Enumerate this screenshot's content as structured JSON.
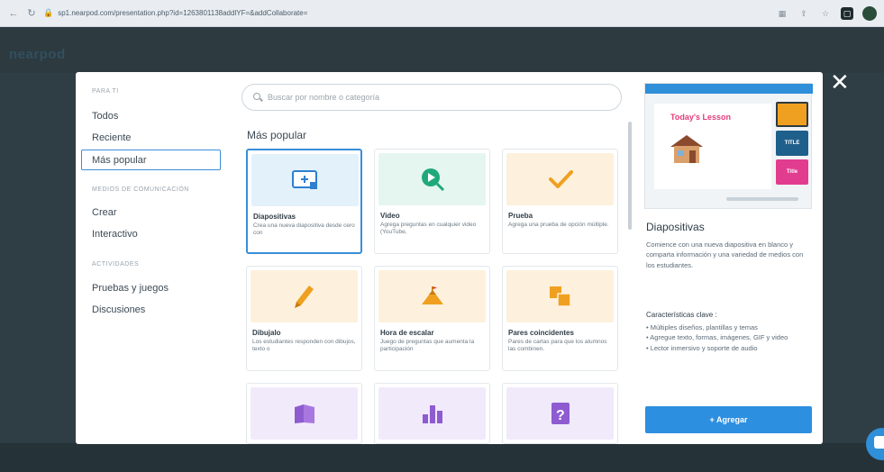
{
  "browser": {
    "url": "sp1.nearpod.com/presentation.php?id=1263801138addlYF=&addCollaborate=",
    "back_glyph": "←",
    "reload_glyph": "↻",
    "lock_glyph": "🔒"
  },
  "app": {
    "logo": "nearpod",
    "close_glyph": "✕"
  },
  "sidebar": {
    "section_1": "PARA TI",
    "items_1": [
      "Todos",
      "Reciente",
      "Más popular"
    ],
    "section_2": "MEDIOS DE COMUNICACIÓN",
    "items_2": [
      "Crear",
      "Interactivo"
    ],
    "section_3": "ACTIVIDADES",
    "items_3": [
      "Pruebas y juegos",
      "Discusiones"
    ]
  },
  "search": {
    "placeholder": "Buscar por nombre o categoría"
  },
  "main": {
    "section_title": "Más popular",
    "cards": [
      {
        "title": "Diapositivas",
        "desc": "Crea una nueva diapositiva desde cero con",
        "color": "#e3f1fb"
      },
      {
        "title": "Video",
        "desc": "Agrega preguntas en cualquier video (YouTube,",
        "color": "#e4f6ef"
      },
      {
        "title": "Prueba",
        "desc": "Agrega una prueba de opción múltiple.",
        "color": "#fdf1dd"
      },
      {
        "title": "Dibujalo",
        "desc": "Los estudiantes responden con dibujos, texto o",
        "color": "#fdf1dd"
      },
      {
        "title": "Hora de escalar",
        "desc": "Juego de preguntas que aumenta la participación",
        "color": "#fdf1dd"
      },
      {
        "title": "Pares coincidentes",
        "desc": "Pares de cartas para que los alumnos las combinen.",
        "color": "#fdf1dd"
      },
      {
        "title": "",
        "desc": "",
        "color": "#f1eafb"
      },
      {
        "title": "",
        "desc": "",
        "color": "#f1eafb"
      },
      {
        "title": "",
        "desc": "",
        "color": "#f1eafb"
      }
    ]
  },
  "preview": {
    "lesson_title": "Today's Lesson",
    "thumbs": [
      "",
      "TITLE",
      "Title"
    ]
  },
  "detail": {
    "title": "Diapositivas",
    "body": "Comience con una nueva diapositiva en blanco y comparta información y una variedad de medios con los estudiantes.",
    "features_title": "Características clave :",
    "features": [
      "• Múltiples diseños, plantillas y temas",
      "• Agregue texto, formas, imágenes, GIF y video",
      "• Lector inmersivo y soporte de audio"
    ],
    "add_label": "+ Agregar"
  }
}
